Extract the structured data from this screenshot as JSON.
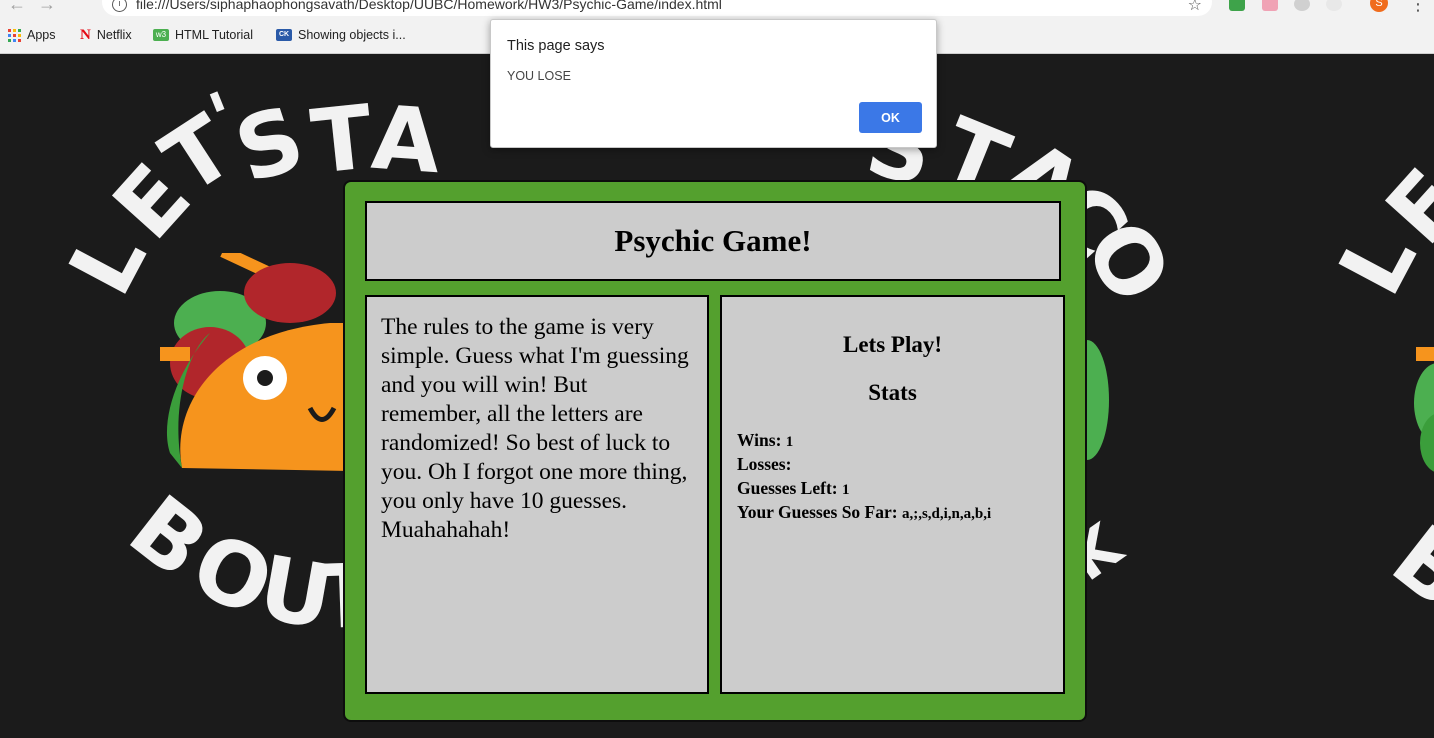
{
  "browser": {
    "url": "file:///Users/siphaphaophongsavath/Desktop/UUBC/Homework/HW3/Psychic-Game/index.html",
    "back_icon": "back-arrow-icon",
    "forward_icon": "forward-arrow-icon",
    "avatar_letter": "S",
    "bookmarks": [
      {
        "label": "Apps",
        "icon": "apps-grid-icon"
      },
      {
        "label": "Netflix",
        "icon": "netflix-icon"
      },
      {
        "label": "HTML Tutorial",
        "icon": "w3schools-icon"
      },
      {
        "label": "Showing objects i...",
        "icon": "site-icon"
      }
    ]
  },
  "background_art": {
    "top_text": "LET'S TACO",
    "bottom_text": "BOUT IT"
  },
  "alert": {
    "title": "This page says",
    "message": "YOU LOSE",
    "ok_label": "OK",
    "ok_color": "#3b78e7"
  },
  "game": {
    "title": "Psychic Game!",
    "rules": "The rules to the game is very simple. Guess what I'm guessing and you will win! But remember, all the letters are randomized! So best of luck to you. Oh I forgot one more thing, you only have 10 guesses. Muahahahah!",
    "play_heading": "Lets Play!",
    "stats_heading": "Stats",
    "stats": {
      "wins_label": "Wins:",
      "wins": "1",
      "losses_label": "Losses:",
      "losses": "",
      "guesses_left_label": "Guesses Left:",
      "guesses_left": "1",
      "guesses_so_far_label": "Your Guesses So Far:",
      "guesses_so_far": "a,;,s,d,i,n,a,b,i"
    },
    "colors": {
      "panel_green": "#54a02e",
      "box_gray": "#cccccc",
      "page_bg": "#1b1b1b"
    }
  }
}
